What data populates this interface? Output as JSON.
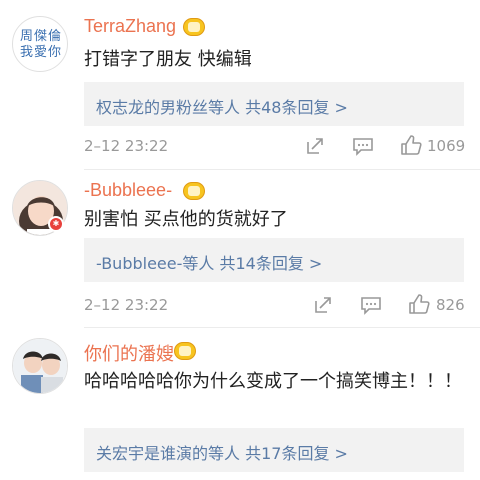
{
  "comments": [
    {
      "avatar_text": "周傑倫\n我愛你",
      "name": "TerraZhang",
      "text": "打错字了朋友 快编辑",
      "reply": "权志龙的男粉丝等人  共48条回复 >",
      "time": "2–12 23:22",
      "likes": "1069"
    },
    {
      "name": "-Bubbleee-",
      "text": "别害怕  买点他的货就好了",
      "reply": "-Bubbleee-等人  共14条回复 >",
      "time": "2–12 23:22",
      "likes": "826"
    },
    {
      "name": "你们的潘嫂",
      "text": "哈哈哈哈哈你为什么变成了一个搞笑博主！！！",
      "reply": "关宏宇是谁演的等人  共17条回复 >"
    }
  ],
  "colors": {
    "username": "#eb7350",
    "reply_link": "#5a7ba6",
    "meta": "#999999",
    "reply_bg": "#f2f2f2"
  },
  "icons": [
    "repost-icon",
    "comment-icon",
    "like-icon",
    "level-badge-icon",
    "verified-badge-icon"
  ]
}
